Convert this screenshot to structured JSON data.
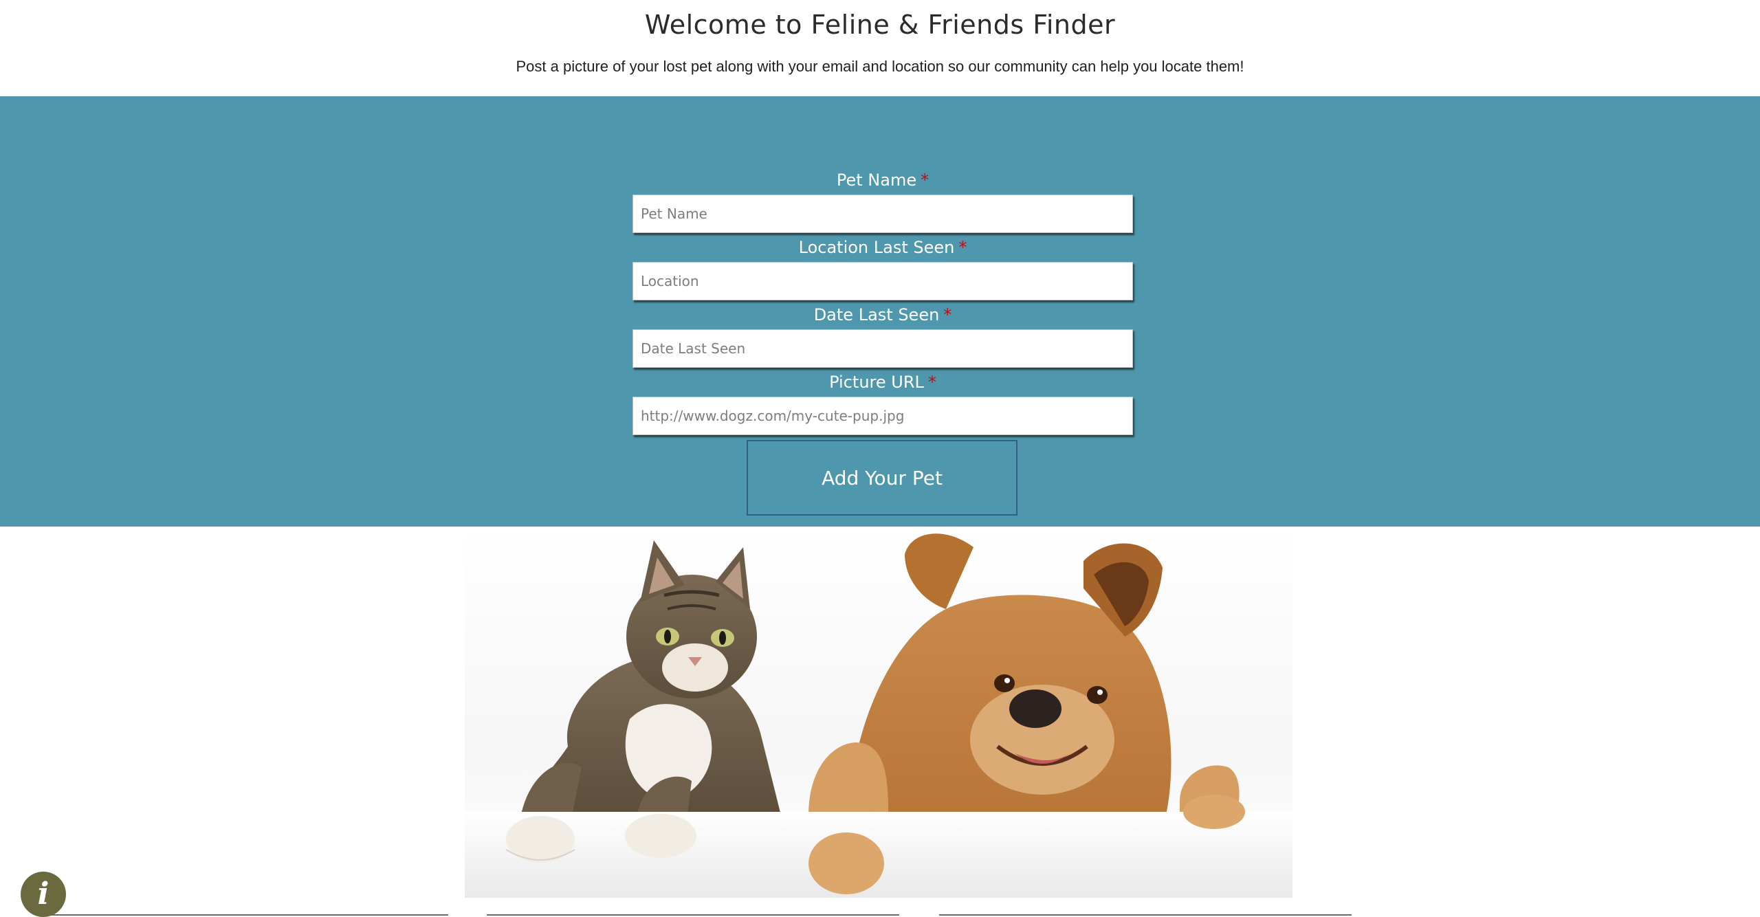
{
  "header": {
    "title": "Welcome to Feline & Friends Finder",
    "subtitle": "Post a picture of your lost pet along with your email and location so our community can help you locate them!"
  },
  "form": {
    "required_marker": "*",
    "fields": [
      {
        "label": "Pet Name",
        "placeholder": "Pet Name",
        "value": ""
      },
      {
        "label": "Location Last Seen",
        "placeholder": "Location",
        "value": ""
      },
      {
        "label": "Date Last Seen",
        "placeholder": "Date Last Seen",
        "value": ""
      },
      {
        "label": "Picture URL",
        "placeholder": "http://www.dogz.com/my-cute-pup.jpg",
        "value": ""
      }
    ],
    "submit_label": "Add Your Pet"
  },
  "info_button": {
    "icon": "info-icon",
    "glyph": "i"
  },
  "colors": {
    "band": "#4e97ac",
    "required": "#b3141b",
    "button_border": "#2e5f86",
    "info_bubble": "#6b6a3f"
  }
}
